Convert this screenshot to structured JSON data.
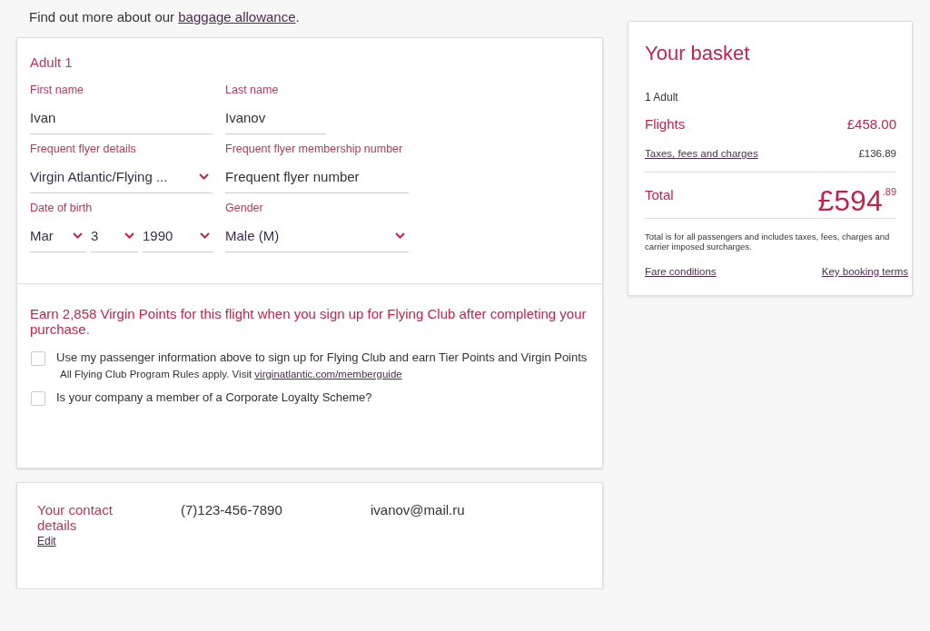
{
  "intro": {
    "text": "Find out more about our ",
    "link": "baggage allowance",
    "end": "."
  },
  "passenger": {
    "title": "Adult 1",
    "rows": [
      [
        {
          "kind": "text",
          "label": "First name",
          "value": "Ivan"
        },
        {
          "kind": "text",
          "label": "Last name",
          "value": "Ivanov"
        }
      ],
      [
        {
          "kind": "select",
          "label": "Frequent flyer details",
          "value": "Virgin Atlantic/Flying ..."
        },
        {
          "kind": "text",
          "label": "Frequent flyer membership number",
          "placeholder": "Frequent flyer number"
        }
      ],
      [
        {
          "kind": "date",
          "label": "Date of birth",
          "parts": [
            "Mar",
            "3",
            "1990"
          ]
        },
        {
          "kind": "select",
          "label": "Gender",
          "value": "Male (M)"
        }
      ]
    ]
  },
  "points": {
    "promo": "Earn 2,858 Virgin Points for this flight when you sign up for Flying Club after completing your purchase.",
    "options": [
      {
        "label": "Use my passenger information above to sign up for Flying Club and earn Tier Points and Virgin Points",
        "note": "All Flying Club Program Rules apply. Visit ",
        "link": "virginatlantic.com/memberguide",
        "checked": false
      },
      {
        "label": "Is your company a member of a Corporate Loyalty Scheme?",
        "checked": false
      }
    ]
  },
  "contact": {
    "title": "Your contact details",
    "edit": "Edit",
    "phone": "(7)123-456-7890",
    "email": "ivanov@mail.ru"
  },
  "basket": {
    "title": "Your basket",
    "passengers": "1 Adult",
    "lines": [
      {
        "kind": "flights",
        "label": "Flights",
        "amount": "£458.00"
      },
      {
        "kind": "taxes",
        "label": "Taxes, fees and charges",
        "amount": "£136.89"
      }
    ],
    "total": {
      "label": "Total",
      "amount": "£594",
      "cents": ".89"
    },
    "note": "Total is for all passengers and includes taxes, fees, charges and carrier imposed surcharges.",
    "links": [
      "Fare conditions",
      "Key booking terms"
    ]
  }
}
